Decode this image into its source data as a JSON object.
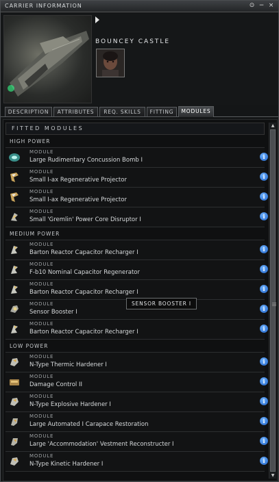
{
  "window": {
    "title": "CARRIER INFORMATION",
    "controls": [
      "settings-icon",
      "minimize-icon",
      "close-icon"
    ]
  },
  "ship": {
    "name": "BOUNCEY CASTLE",
    "image": "carrier-ship-render",
    "pilot": "pilot-portrait"
  },
  "tabs": [
    {
      "label": "DESCRIPTION",
      "active": false
    },
    {
      "label": "ATTRIBUTES",
      "active": false
    },
    {
      "label": "REQ. SKILLS",
      "active": false
    },
    {
      "label": "FITTING",
      "active": false
    },
    {
      "label": "MODULES",
      "active": true
    }
  ],
  "list": {
    "header": "FITTED MODULES",
    "sections": [
      {
        "title": "HIGH POWER",
        "rows": [
          {
            "kind": "MODULE",
            "name": "Large Rudimentary Concussion Bomb I",
            "icon": "bomb-icon"
          },
          {
            "kind": "MODULE",
            "name": "Small I-ax Regenerative Projector",
            "icon": "projector-icon"
          },
          {
            "kind": "MODULE",
            "name": "Small I-ax Regenerative Projector",
            "icon": "projector-icon"
          },
          {
            "kind": "MODULE",
            "name": "Small 'Gremlin' Power Core Disruptor I",
            "icon": "disruptor-icon"
          }
        ]
      },
      {
        "title": "MEDIUM POWER",
        "rows": [
          {
            "kind": "MODULE",
            "name": "Barton Reactor Capacitor Recharger I",
            "icon": "capacitor-icon"
          },
          {
            "kind": "MODULE",
            "name": "F-b10 Nominal Capacitor Regenerator",
            "icon": "capacitor-icon"
          },
          {
            "kind": "MODULE",
            "name": "Barton Reactor Capacitor Recharger I",
            "icon": "capacitor-icon"
          },
          {
            "kind": "MODULE",
            "name": "Sensor Booster I",
            "icon": "sensor-icon"
          },
          {
            "kind": "MODULE",
            "name": "Barton Reactor Capacitor Recharger I",
            "icon": "capacitor-icon"
          }
        ]
      },
      {
        "title": "LOW POWER",
        "rows": [
          {
            "kind": "MODULE",
            "name": "N-Type Thermic Hardener I",
            "icon": "hardener-icon"
          },
          {
            "kind": "MODULE",
            "name": "Damage Control II",
            "icon": "damage-control-icon"
          },
          {
            "kind": "MODULE",
            "name": "N-Type Explosive Hardener I",
            "icon": "hardener-icon"
          },
          {
            "kind": "MODULE",
            "name": "Large Automated I Carapace Restoration",
            "icon": "armor-icon"
          },
          {
            "kind": "MODULE",
            "name": "Large 'Accommodation' Vestment Reconstructer I",
            "icon": "armor-icon"
          },
          {
            "kind": "MODULE",
            "name": "N-Type Kinetic Hardener I",
            "icon": "hardener-icon"
          }
        ]
      }
    ]
  },
  "tooltip": "SENSOR BOOSTER I",
  "colors": {
    "background": "#141617",
    "info_blue": "#2f7ee0",
    "text": "#d7dadc"
  }
}
